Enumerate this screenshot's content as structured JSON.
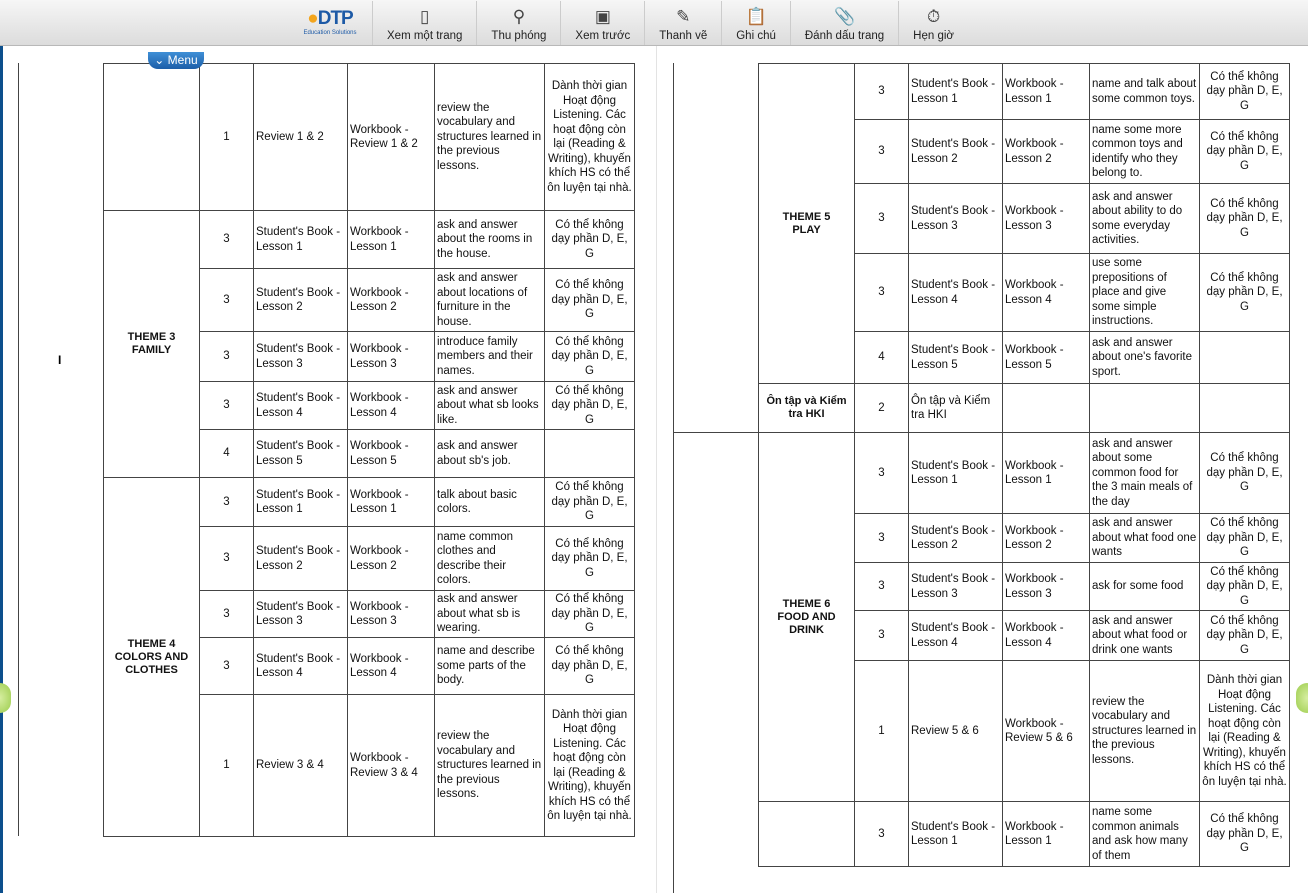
{
  "toolbar": {
    "logo": {
      "brand": "DTP",
      "tagline": "Education Solutions"
    },
    "items": [
      {
        "label": "Xem một trang",
        "icon": "single-page-icon"
      },
      {
        "label": "Thu phóng",
        "icon": "zoom-icon"
      },
      {
        "label": "Xem trước",
        "icon": "preview-icon"
      },
      {
        "label": "Thanh vẽ",
        "icon": "pencil-icon"
      },
      {
        "label": "Ghi chú",
        "icon": "note-icon"
      },
      {
        "label": "Đánh dấu trang",
        "icon": "bookmark-clip-icon"
      },
      {
        "label": "Hẹn giờ",
        "icon": "timer-icon"
      }
    ],
    "menu_label": "Menu"
  },
  "left_page": {
    "section": "I",
    "groups": [
      {
        "theme": "",
        "rows": [
          [
            "1",
            "Review 1 & 2",
            "Workbook - Review 1 & 2",
            "review the vocabulary and structures learned in the previous lessons.",
            "Dành thời gian Hoạt động Listening. Các hoạt động còn lại (Reading & Writing), khuyến khích HS có thể ôn luyện tại nhà."
          ]
        ]
      },
      {
        "theme": "THEME 3\nFAMILY",
        "rows": [
          [
            "3",
            "Student's Book - Lesson 1",
            "Workbook - Lesson 1",
            "ask and answer about the rooms in the house.",
            "Có thể không dạy phần D, E, G"
          ],
          [
            "3",
            "Student's Book - Lesson 2",
            "Workbook - Lesson 2",
            "ask and answer about locations of furniture in the house.",
            "Có thể không dạy phần D, E, G"
          ],
          [
            "3",
            "Student's Book - Lesson 3",
            "Workbook - Lesson 3",
            "introduce family members and their names.",
            "Có thể không dạy phần D, E, G"
          ],
          [
            "3",
            "Student's Book - Lesson 4",
            "Workbook - Lesson 4",
            "ask and answer about what sb looks like.",
            "Có thể không dạy phần D, E, G"
          ],
          [
            "4",
            "Student's Book - Lesson 5",
            "Workbook - Lesson 5",
            "ask and answer about sb's job.",
            ""
          ]
        ]
      },
      {
        "theme": "THEME 4\nCOLORS AND\nCLOTHES",
        "rows": [
          [
            "3",
            "Student's Book - Lesson 1",
            "Workbook - Lesson 1",
            "talk about basic colors.",
            "Có thể không dạy phần D, E, G"
          ],
          [
            "3",
            "Student's Book - Lesson 2",
            "Workbook - Lesson 2",
            "name common clothes and describe their colors.",
            "Có thể không dạy phần D, E, G"
          ],
          [
            "3",
            "Student's Book - Lesson 3",
            "Workbook - Lesson 3",
            "ask and answer about what sb is wearing.",
            "Có thể không dạy phần D, E, G"
          ],
          [
            "3",
            "Student's Book - Lesson 4",
            "Workbook - Lesson 4",
            "name and describe some parts of the body.",
            "Có thể không dạy phần D, E, G"
          ],
          [
            "1",
            "Review 3 & 4",
            "Workbook - Review 3 & 4",
            "review the vocabulary and structures learned in the previous lessons.",
            "Dành thời gian Hoạt động Listening. Các hoạt động còn lại (Reading & Writing), khuyến khích HS có thể ôn luyện tại nhà."
          ]
        ]
      }
    ]
  },
  "right_page": {
    "groups": [
      {
        "theme": "THEME 5\nPLAY",
        "rows": [
          [
            "3",
            "Student's Book - Lesson 1",
            "Workbook - Lesson 1",
            "name and talk about some common toys.",
            "Có thể không dạy phần D, E, G"
          ],
          [
            "3",
            "Student's Book - Lesson 2",
            "Workbook - Lesson 2",
            "name some more common toys and identify who they belong to.",
            "Có thể không dạy phần D, E, G"
          ],
          [
            "3",
            "Student's Book - Lesson 3",
            "Workbook - Lesson 3",
            "ask and answer about ability to do some everyday activities.",
            "Có thể không dạy phần D, E, G"
          ],
          [
            "3",
            "Student's Book - Lesson 4",
            "Workbook - Lesson 4",
            "use some prepositions of place and give some simple instructions.",
            "Có thể không dạy phần D, E, G"
          ],
          [
            "4",
            "Student's Book - Lesson 5",
            "Workbook - Lesson 5",
            "ask and answer about one's favorite sport.",
            ""
          ]
        ]
      },
      {
        "theme": "Ôn tập và Kiểm\ntra HKI",
        "rows": [
          [
            "2",
            "Ôn tập và Kiểm tra HKI",
            "",
            "",
            ""
          ]
        ]
      },
      {
        "theme": "THEME 6\nFOOD AND\nDRINK",
        "rows": [
          [
            "3",
            "Student's Book - Lesson 1",
            "Workbook - Lesson 1",
            "ask and answer about some common food for the 3 main meals of the day",
            "Có thể không dạy phần D, E, G"
          ],
          [
            "3",
            "Student's Book - Lesson 2",
            "Workbook - Lesson 2",
            "ask and answer about what food one wants",
            "Có thể không dạy phần D, E, G"
          ],
          [
            "3",
            "Student's Book - Lesson 3",
            "Workbook - Lesson 3",
            "ask for some food",
            "Có thể không dạy phần D, E, G"
          ],
          [
            "3",
            "Student's Book - Lesson 4",
            "Workbook - Lesson 4",
            "ask and answer about what food or drink one wants",
            "Có thể không dạy phần D, E, G"
          ],
          [
            "1",
            "Review 5 & 6",
            "Workbook - Review 5 & 6",
            "review the vocabulary and structures learned in the previous lessons.",
            "Dành thời gian Hoạt động Listening. Các hoạt động còn lại (Reading & Writing), khuyến khích HS có thể ôn luyện tại nhà."
          ]
        ]
      },
      {
        "theme": "",
        "rows": [
          [
            "3",
            "Student's Book - Lesson 1",
            "Workbook - Lesson 1",
            "name some common animals and ask how many of them",
            "Có thể không dạy phần D, E, G"
          ]
        ]
      }
    ]
  }
}
